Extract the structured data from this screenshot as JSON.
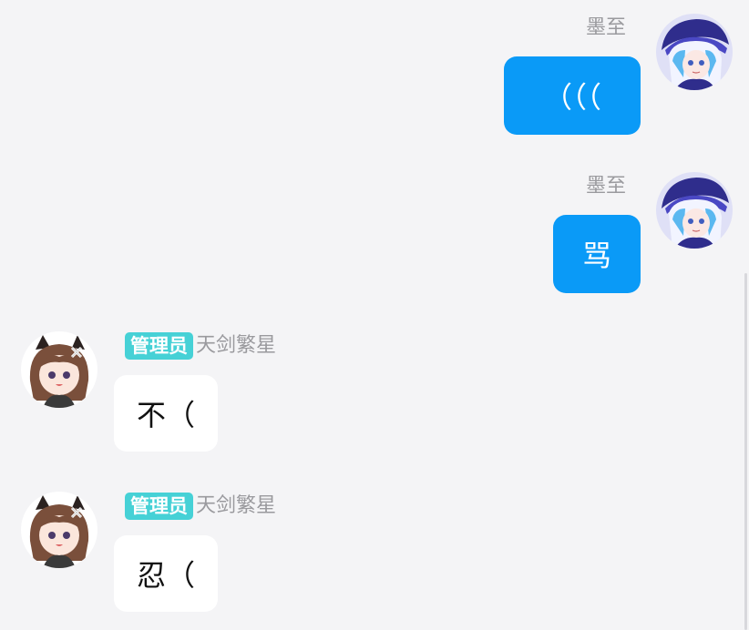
{
  "messages": [
    {
      "side": "right",
      "sender": "墨至",
      "text": "（（（",
      "avatar": "blue-hat-character-avatar"
    },
    {
      "side": "right",
      "sender": "墨至",
      "text": "骂",
      "avatar": "blue-hat-character-avatar"
    },
    {
      "side": "left",
      "role": "管理员",
      "sender": "天剑繁星",
      "text": "不（",
      "avatar": "brown-hair-girl-avatar"
    },
    {
      "side": "left",
      "role": "管理员",
      "sender": "天剑繁星",
      "text": "忍（",
      "avatar": "brown-hair-girl-avatar"
    }
  ],
  "colors": {
    "background": "#f4f4f6",
    "self_bubble": "#0a9af7",
    "other_bubble": "#ffffff",
    "role_badge": "#46d1d6",
    "name_text": "#9a9a9e"
  }
}
